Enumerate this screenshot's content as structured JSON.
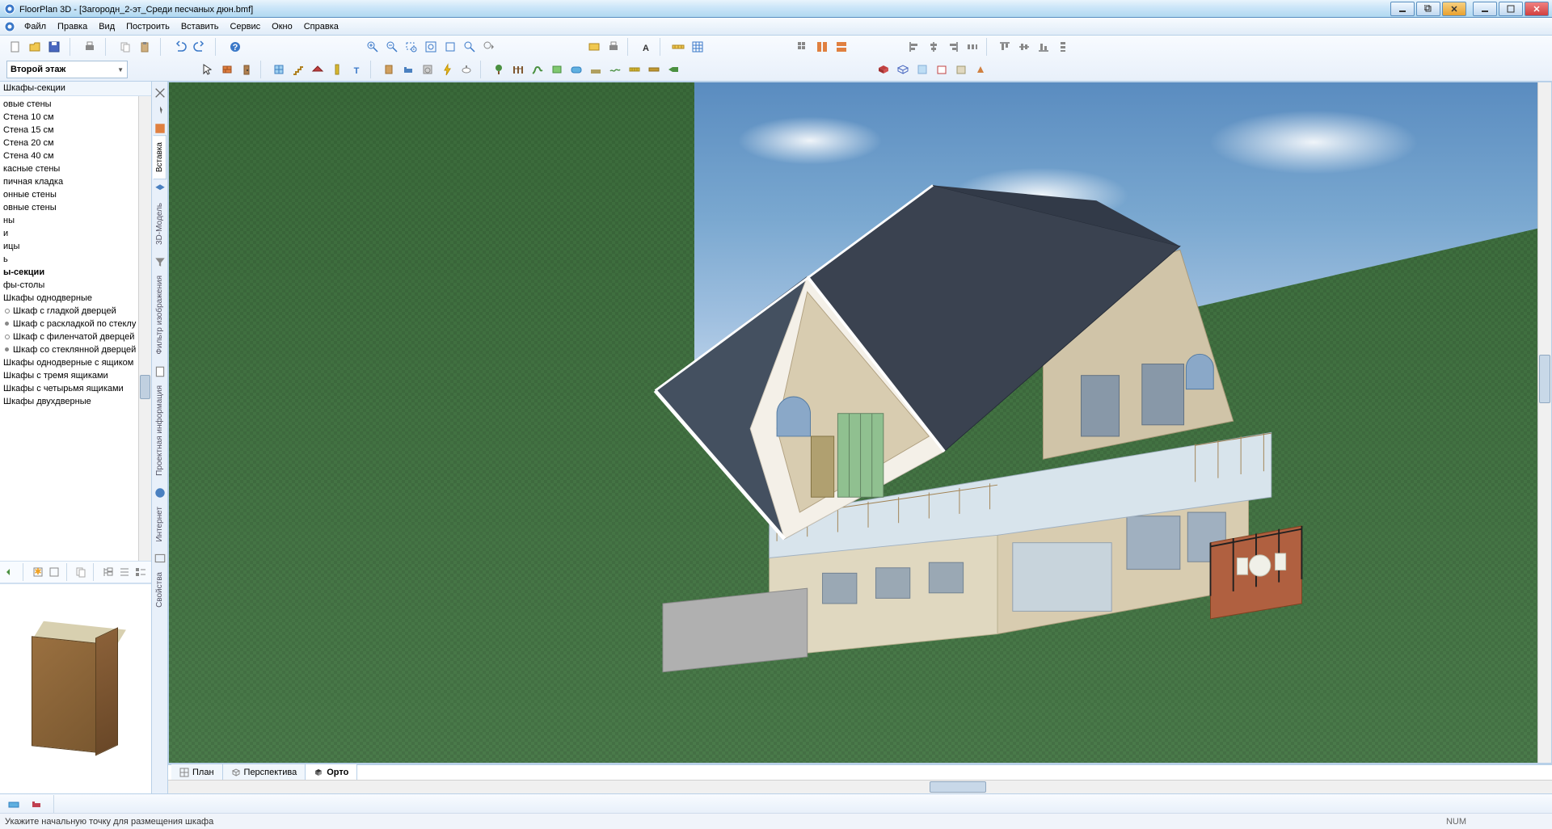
{
  "window": {
    "app_name": "FloorPlan 3D",
    "doc_name": "[Загородн_2-эт_Среди песчаных дюн.bmf]",
    "title_sep": " - "
  },
  "menus": [
    "Файл",
    "Правка",
    "Вид",
    "Построить",
    "Вставить",
    "Сервис",
    "Окно",
    "Справка"
  ],
  "floor_selector": {
    "value": "Второй этаж"
  },
  "side_panel": {
    "title": "Шкафы-секции",
    "items": [
      {
        "label": "овые стены"
      },
      {
        "label": "Стена 10 см"
      },
      {
        "label": "Стена 15 см"
      },
      {
        "label": "Стена 20 см"
      },
      {
        "label": "Стена 40 см"
      },
      {
        "label": "касные стены"
      },
      {
        "label": "пичная кладка"
      },
      {
        "label": "онные стены"
      },
      {
        "label": "овные стены"
      },
      {
        "label": "ны"
      },
      {
        "label": "и"
      },
      {
        "label": "ицы"
      },
      {
        "label": "ь"
      },
      {
        "label": "ы-секции",
        "bold": true
      },
      {
        "label": "фы-столы"
      },
      {
        "label": "Шкафы однодверные"
      },
      {
        "label": "Шкаф с гладкой дверцей",
        "sub": true,
        "open": true
      },
      {
        "label": "Шкаф с раскладкой по стеклу",
        "sub": true
      },
      {
        "label": "Шкаф с филенчатой дверцей",
        "sub": true,
        "open": true
      },
      {
        "label": "Шкаф со стеклянной дверцей",
        "sub": true
      },
      {
        "label": "Шкафы однодверные с ящиком"
      },
      {
        "label": "Шкафы с тремя ящиками"
      },
      {
        "label": "Шкафы с четырьмя ящиками"
      },
      {
        "label": "Шкафы двухдверные"
      }
    ]
  },
  "vtabs": [
    "Вставка",
    "3D-Модель",
    "Фильтр изображения",
    "Проектная информация",
    "Интернет",
    "Свойства"
  ],
  "view_tabs": [
    {
      "label": "План",
      "active": false
    },
    {
      "label": "Перспектива",
      "active": false
    },
    {
      "label": "Орто",
      "active": true
    }
  ],
  "statusbar2": {
    "hint": "Укажите начальную точку для размещения шкафа",
    "indicator": "NUM"
  }
}
